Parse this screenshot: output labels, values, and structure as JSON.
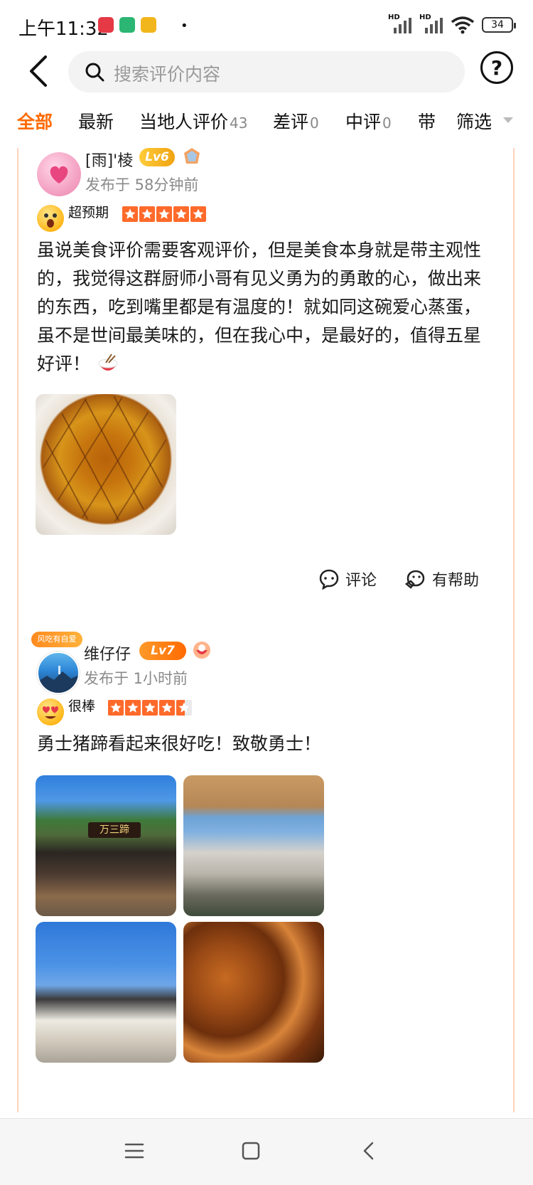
{
  "status_bar": {
    "time": "上午11:32",
    "network": [
      "HD",
      "HD"
    ],
    "battery": "34",
    "app_colors": [
      "#e63946",
      "#2bb673",
      "#f2b61d"
    ]
  },
  "header": {
    "search_placeholder": "搜索评价内容",
    "help_label": "?"
  },
  "tabs": [
    {
      "label": "全部",
      "count": "",
      "active": true
    },
    {
      "label": "最新",
      "count": ""
    },
    {
      "label": "当地人评价",
      "count": "43"
    },
    {
      "label": "差评",
      "count": "0"
    },
    {
      "label": "中评",
      "count": "0"
    },
    {
      "label": "带",
      "count": ""
    }
  ],
  "filter": {
    "label": "筛选"
  },
  "accent_color": "#ff6a00",
  "reviews": [
    {
      "user": "[雨]'棱",
      "level": "Lv6",
      "posted": "发布于 58分钟前",
      "rating_label": "超预期",
      "stars": 5,
      "text": "虽说美食评价需要客观评价，但是美食本身就是带主观性的，我觉得这群厨师小哥有见义勇为的勇敢的心，做出来的东西，吃到嘴里都是有温度的！就如同这碗爱心蒸蛋，虽不是世间最美味的，但在我心中，是最好的，值得五星好评！",
      "photos": [
        "photo-egg"
      ],
      "actions": {
        "comment": "评论",
        "helpful": "有帮助"
      }
    },
    {
      "user": "维仔仔",
      "level": "Lv7",
      "avatar_badge": "风吃有自爱",
      "posted": "发布于 1小时前",
      "rating_label": "很棒",
      "stars": 4.5,
      "text": "勇士猪蹄看起来很好吃！致敬勇士！",
      "photos": [
        "photo-shop",
        "photo-bridge",
        "photo-street",
        "photo-food"
      ],
      "photo_shop_sign": "万三蹄"
    }
  ]
}
